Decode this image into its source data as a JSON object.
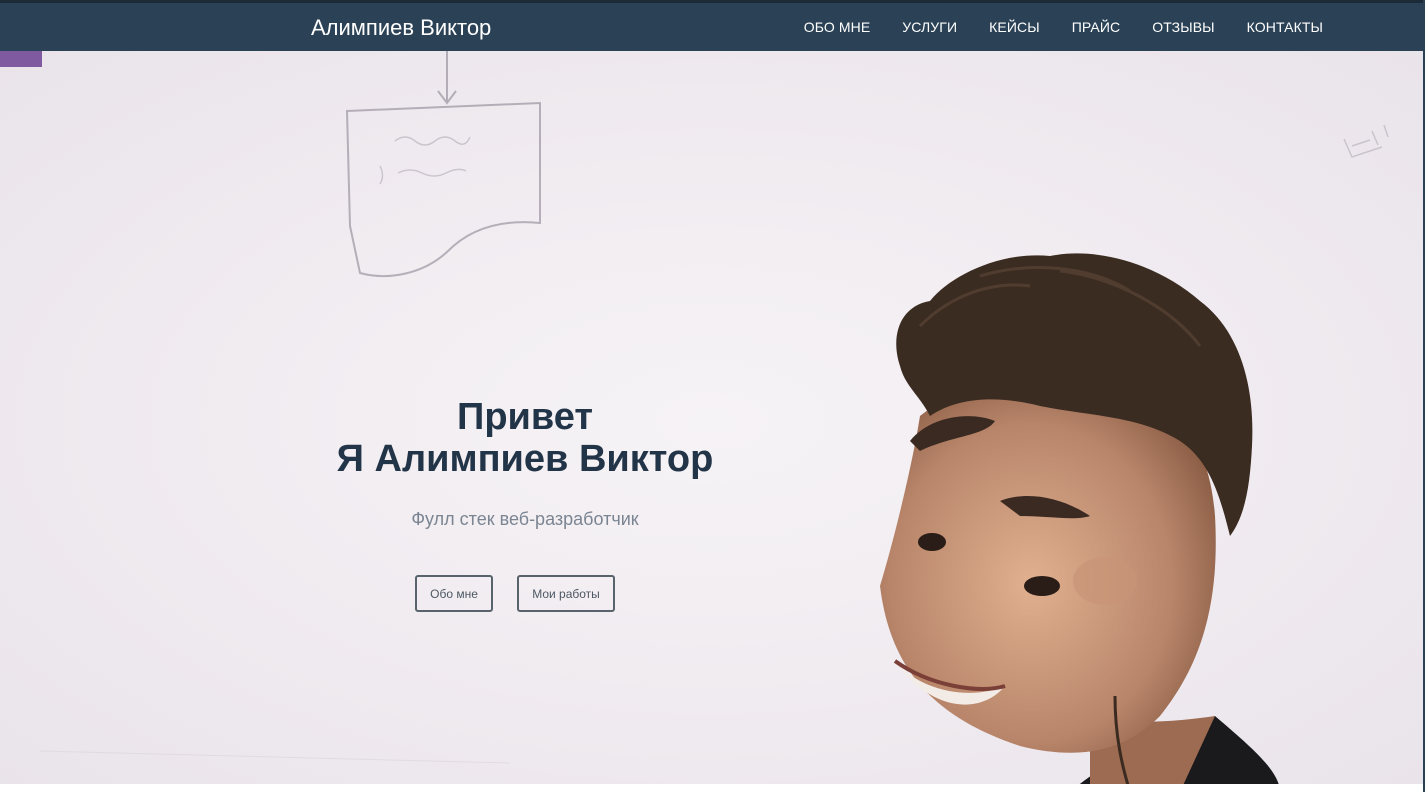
{
  "header": {
    "brand": "Алимпиев Виктор",
    "nav": [
      "ОБО МНЕ",
      "УСЛУГИ",
      "КЕЙСЫ",
      "ПРАЙС",
      "ОТЗЫВЫ",
      "КОНТАКТЫ"
    ]
  },
  "hero": {
    "title_line1": "Привет",
    "title_line2": "Я Алимпиев Виктор",
    "subtitle": "Фулл стек веб-разработчик",
    "button_about": "Обо мне",
    "button_works": "Мои работы"
  },
  "colors": {
    "header_bg": "#2b4256",
    "title_text": "#223447",
    "subtitle_text": "#7b8592",
    "button_border": "#59636c"
  }
}
